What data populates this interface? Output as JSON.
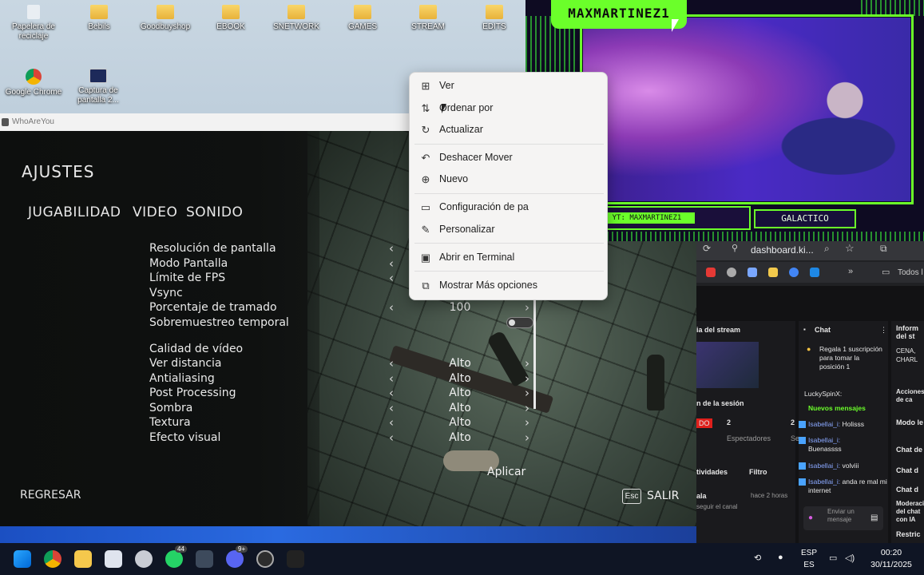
{
  "desktop": {
    "icons": [
      {
        "label": "Papelera de reciclaje",
        "icon": "recycle-bin-icon"
      },
      {
        "label": "Bebils",
        "icon": "folder-icon"
      },
      {
        "label": "Goodbuyshop",
        "icon": "folder-icon"
      },
      {
        "label": "EBOOK",
        "icon": "folder-icon"
      },
      {
        "label": "SNETWORK",
        "icon": "folder-icon"
      },
      {
        "label": "GAMES",
        "icon": "folder-icon"
      },
      {
        "label": "STREAM",
        "icon": "folder-icon"
      },
      {
        "label": "EDITS",
        "icon": "folder-icon"
      },
      {
        "label": "Google Chrome",
        "icon": "chrome-icon"
      },
      {
        "label": "Captura de pantalla 2...",
        "icon": "image-file-icon"
      }
    ]
  },
  "game": {
    "window_title": "WhoAreYou",
    "settings_title": "AJUSTES",
    "tabs": [
      "JUGABILIDAD",
      "VIDEO",
      "SONIDO"
    ],
    "settings": [
      {
        "label": "Resolución de pantalla",
        "value": ""
      },
      {
        "label": "Modo Pantalla",
        "value": ""
      },
      {
        "label": "Límite de FPS",
        "value": ""
      },
      {
        "label": "Vsync",
        "value": ""
      },
      {
        "label": "Porcentaje de tramado",
        "value": "100"
      },
      {
        "label": "Sobremuestreo temporal",
        "value": ""
      },
      {
        "label": "Calidad de vídeo",
        "value": ""
      },
      {
        "label": "Ver distancia",
        "value": "Alto"
      },
      {
        "label": "Antialiasing",
        "value": "Alto"
      },
      {
        "label": "Post Processing",
        "value": "Alto"
      },
      {
        "label": "Sombra",
        "value": "Alto"
      },
      {
        "label": "Textura",
        "value": "Alto"
      },
      {
        "label": "Efecto visual",
        "value": "Alto"
      }
    ],
    "apply_label": "Aplicar",
    "back_label": "REGRESAR",
    "esc_key": "Esc",
    "exit_label": "SALIR"
  },
  "context_menu": {
    "items": [
      {
        "label": "Ver",
        "icon": "grid-view-icon"
      },
      {
        "label": "Ordenar por",
        "icon": "sort-icon"
      },
      {
        "label": "Actualizar",
        "icon": "refresh-icon"
      },
      {
        "label": "Deshacer Mover",
        "icon": "undo-icon"
      },
      {
        "label": "Nuevo",
        "icon": "plus-circle-icon"
      },
      {
        "label": "Configuración de pa",
        "icon": "display-settings-icon"
      },
      {
        "label": "Personalizar",
        "icon": "brush-icon"
      },
      {
        "label": "Abrir en Terminal",
        "icon": "terminal-icon"
      },
      {
        "label": "Mostrar Más opciones",
        "icon": "more-options-icon"
      }
    ]
  },
  "stream_overlay": {
    "streamer_name": "MAXMARTINEZ1",
    "yt_tag": "YT: MAXMARTINEZ1",
    "rank_label": "GALACTICO",
    "accent_color": "#6bff2a"
  },
  "browser": {
    "address": "dashboard.ki...",
    "all_bookmarks": "Todos l",
    "dashboard": {
      "stream_panel_title": "ia del stream",
      "chat_title": "Chat",
      "right_panel_title": "Inform del st",
      "right_panel_text": "CENA, CHARL",
      "gift_notice": "Regala 1 suscripción para tomar la posición 1",
      "first_user": "LuckySpinX:",
      "new_messages": "Nuevos mensajes",
      "messages": [
        {
          "user": "Isabellai_i:",
          "text": "Holisss"
        },
        {
          "user": "Isabellai_i:",
          "text": "Buenassss"
        },
        {
          "user": "Isabellai_i:",
          "text": "volviii"
        },
        {
          "user": "Isabellai_i:",
          "text": "anda re mal mi internet"
        }
      ],
      "session_title": "n de la sesión",
      "live_badge": "DO",
      "viewers_count": "2",
      "viewers_label": "Espectadores",
      "second_count": "2",
      "second_label": "Se",
      "activities_title": "tividades",
      "filter_label": "Filtro",
      "activity_name": "ala",
      "activity_time": "hace 2 horas",
      "activity_desc": "seguir el canal",
      "chat_input_placeholder": "Enviar un mensaje",
      "side_items": [
        "Acciones de ca",
        "Modo le",
        "Chat de",
        "Chat d",
        "Chat d",
        "Moderación del chat con IA",
        "Restric"
      ]
    }
  },
  "taskbar": {
    "apps": [
      "windows-start-icon",
      "chrome-icon",
      "file-explorer-icon",
      "app-icon",
      "steam-icon",
      "whatsapp-icon",
      "calculator-icon",
      "discord-icon",
      "obs-icon",
      "game-icon"
    ],
    "whatsapp_badge": "44",
    "discord_badge": "9+",
    "language": "ESP",
    "region": "ES",
    "time": "00:20",
    "date": "30/11/2025"
  }
}
